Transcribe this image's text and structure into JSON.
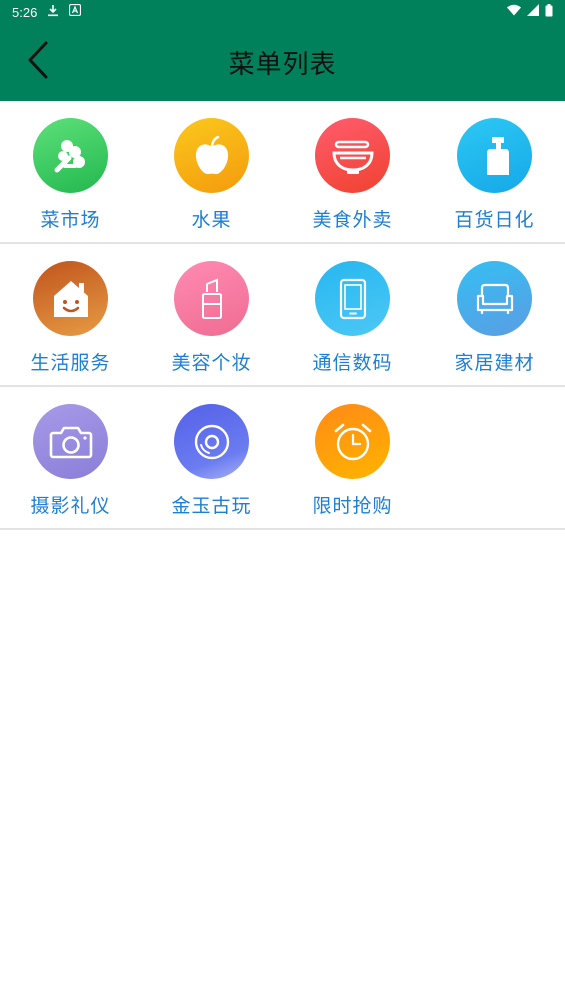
{
  "status_bar": {
    "time": "5:26",
    "icons": [
      "download-icon",
      "a-badge-icon",
      "wifi-icon",
      "signal-icon",
      "battery-icon"
    ]
  },
  "app_bar": {
    "title": "菜单列表",
    "back_icon": "chevron-left-icon"
  },
  "menu": {
    "rows": [
      {
        "items": [
          {
            "label": "菜市场",
            "icon": "vegetable-icon"
          },
          {
            "label": "水果",
            "icon": "apple-icon"
          },
          {
            "label": "美食外卖",
            "icon": "noodle-bowl-icon"
          },
          {
            "label": "百货日化",
            "icon": "spray-bottle-icon"
          }
        ]
      },
      {
        "items": [
          {
            "label": "生活服务",
            "icon": "smiling-house-icon"
          },
          {
            "label": "美容个妆",
            "icon": "lipstick-icon"
          },
          {
            "label": "通信数码",
            "icon": "smartphone-icon"
          },
          {
            "label": "家居建材",
            "icon": "sofa-icon"
          }
        ]
      },
      {
        "items": [
          {
            "label": "摄影礼仪",
            "icon": "camera-icon"
          },
          {
            "label": "金玉古玩",
            "icon": "jade-disc-icon"
          },
          {
            "label": "限时抢购",
            "icon": "alarm-clock-icon"
          }
        ]
      }
    ]
  },
  "colors": {
    "header": "#00815b",
    "label": "#1d7fd2",
    "divider": "#e3e3e3"
  }
}
